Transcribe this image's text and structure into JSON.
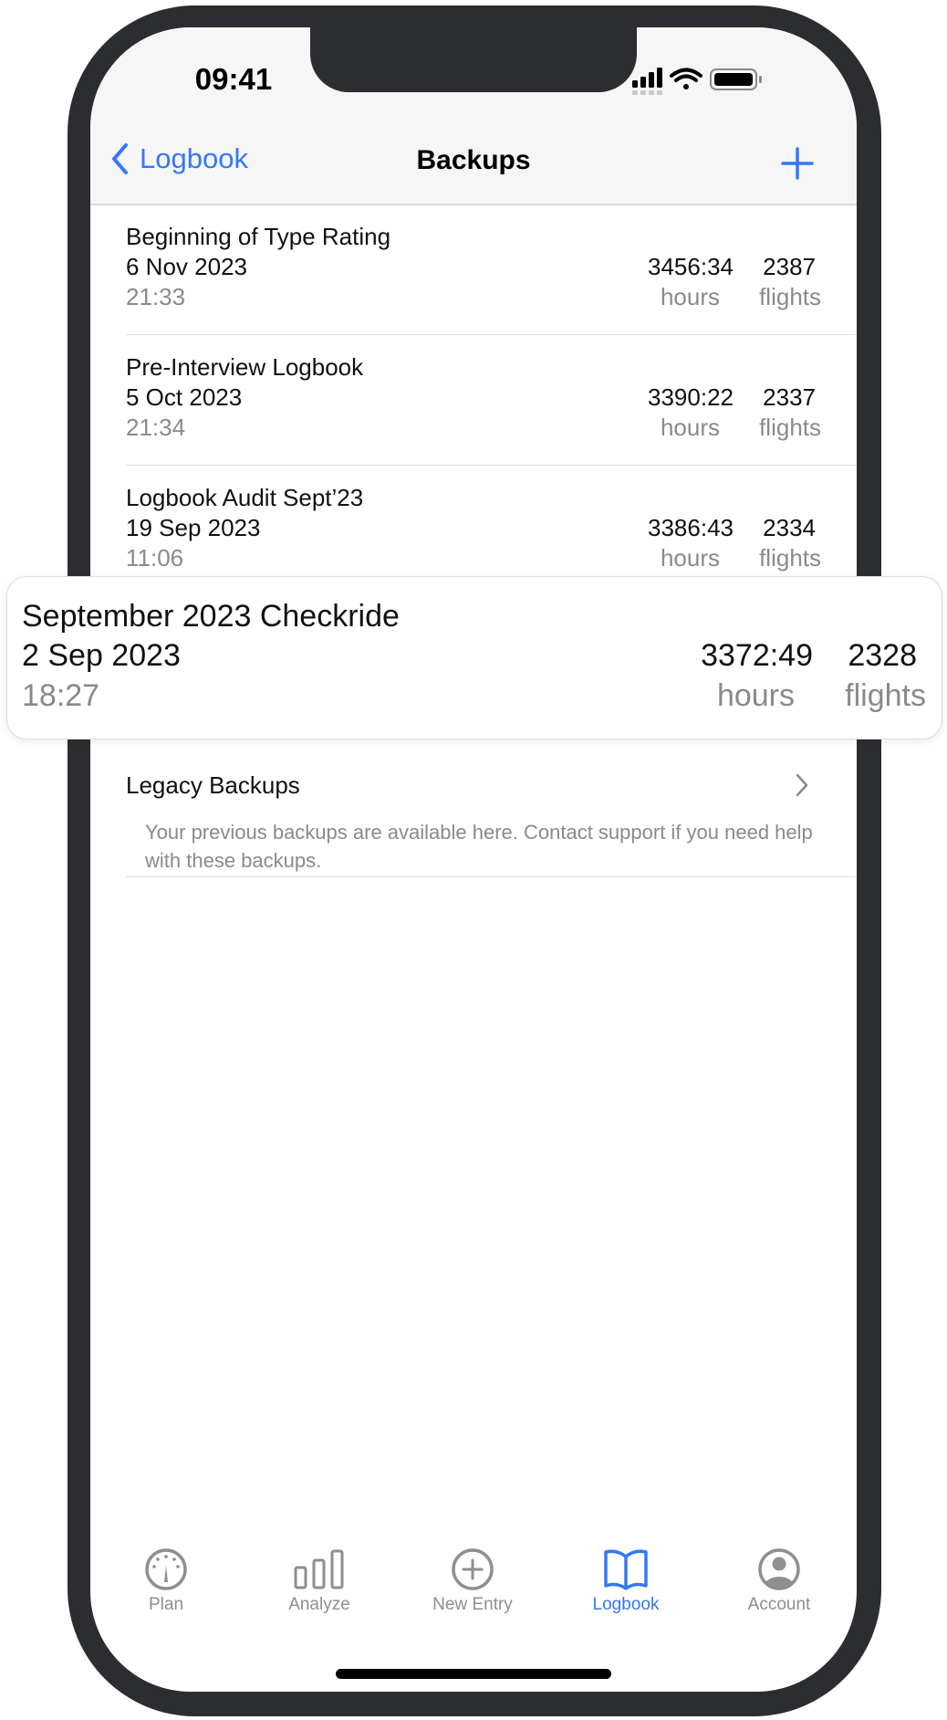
{
  "status_bar": {
    "time": "09:41"
  },
  "nav": {
    "back_label": "Logbook",
    "title": "Backups",
    "add_icon": "plus-icon",
    "accent": "#3478f6"
  },
  "backups": [
    {
      "name": "Beginning of Type Rating",
      "date": "6 Nov 2023",
      "time": "21:33",
      "hours": "3456:34",
      "hours_label": "hours",
      "flights": "2387",
      "flights_label": "flights"
    },
    {
      "name": "Pre-Interview Logbook",
      "date": "5 Oct 2023",
      "time": "21:34",
      "hours": "3390:22",
      "hours_label": "hours",
      "flights": "2337",
      "flights_label": "flights"
    },
    {
      "name": "Logbook Audit Sept’23",
      "date": "19 Sep 2023",
      "time": "11:06",
      "hours": "3386:43",
      "hours_label": "hours",
      "flights": "2334",
      "flights_label": "flights"
    }
  ],
  "lifted_backup": {
    "name": "September 2023 Checkride",
    "date": "2 Sep 2023",
    "time": "18:27",
    "hours": "3372:49",
    "hours_label": "hours",
    "flights": "2328",
    "flights_label": "flights"
  },
  "legacy": {
    "label": "Legacy Backups",
    "note": "Your previous backups are available here. Contact support if you need help with these backups."
  },
  "tabs": [
    {
      "label": "Plan",
      "icon": "gauge-icon"
    },
    {
      "label": "Analyze",
      "icon": "bar-chart-icon"
    },
    {
      "label": "New Entry",
      "icon": "plus-circle-icon"
    },
    {
      "label": "Logbook",
      "icon": "book-icon",
      "active": true
    },
    {
      "label": "Account",
      "icon": "person-circle-icon"
    }
  ]
}
